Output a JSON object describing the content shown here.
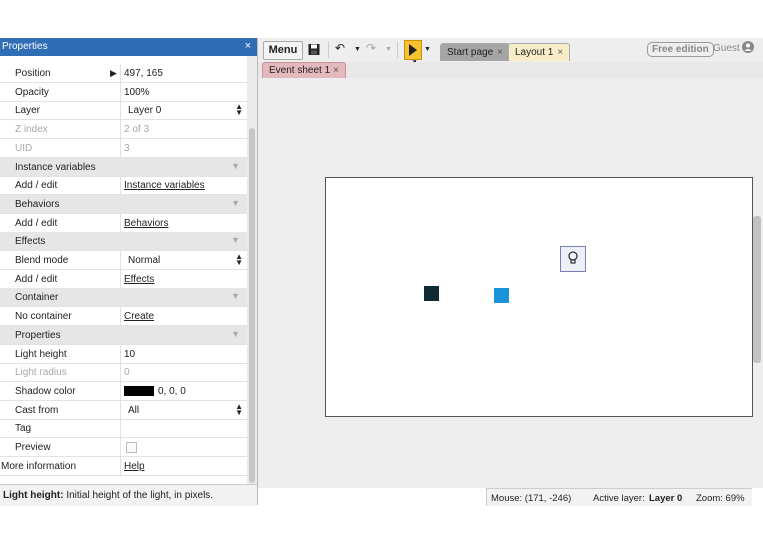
{
  "properties_panel": {
    "title": "Properties",
    "close_glyph": "×",
    "rows": [
      {
        "key": "Position",
        "value": "497, 165",
        "type": "expand"
      },
      {
        "key": "Opacity",
        "value": "100%",
        "type": "text"
      },
      {
        "key": "Layer",
        "value": "Layer 0",
        "type": "select"
      },
      {
        "key": "Z index",
        "value": "2 of 3",
        "type": "dim"
      },
      {
        "key": "UID",
        "value": "3",
        "type": "dim"
      },
      {
        "key": "Instance variables",
        "type": "section"
      },
      {
        "key": "Add / edit",
        "value": "Instance variables",
        "type": "link"
      },
      {
        "key": "Behaviors",
        "type": "section"
      },
      {
        "key": "Add / edit",
        "value": "Behaviors",
        "type": "link"
      },
      {
        "key": "Effects",
        "type": "section"
      },
      {
        "key": "Blend mode",
        "value": "Normal",
        "type": "select"
      },
      {
        "key": "Add / edit",
        "value": "Effects",
        "type": "link"
      },
      {
        "key": "Container",
        "type": "section"
      },
      {
        "key": "No container",
        "value": "Create",
        "type": "link"
      },
      {
        "key": "Properties",
        "type": "section"
      },
      {
        "key": "Light height",
        "value": "10",
        "type": "text"
      },
      {
        "key": "Light radius",
        "value": "0",
        "type": "dim"
      },
      {
        "key": "Shadow color",
        "value": "0, 0, 0",
        "type": "color"
      },
      {
        "key": "Cast from",
        "value": "All",
        "type": "select"
      },
      {
        "key": "Tag",
        "value": "",
        "type": "text"
      },
      {
        "key": "Preview",
        "value": "",
        "type": "checkbox"
      },
      {
        "key": "More information",
        "value": "Help",
        "type": "link-wide"
      }
    ],
    "help_bold": "Light height:",
    "help_text": " Initial height of the light, in pixels."
  },
  "toolbar": {
    "menu_label": "Menu",
    "tabs": [
      {
        "label": "Start page",
        "close": "×"
      },
      {
        "label": "Layout 1",
        "close": "×"
      }
    ],
    "free_edition": "Free edition",
    "guest": "Guest"
  },
  "event_tab": {
    "label": "Event sheet 1",
    "close": "×"
  },
  "status_bar": {
    "mouse": "Mouse: (171, -246)",
    "active_layer_label": "Active layer:",
    "active_layer_value": "Layer 0",
    "zoom": "Zoom: 69%"
  },
  "colors": {
    "title_bar": "#2f6db5",
    "play_button": "#f6c232",
    "layout_tab": "#f7ecc8",
    "event_tab": "#e5b8bd",
    "sprite_dark": "#0e2a33",
    "sprite_blue": "#1994d8",
    "shadow_color_swatch": "#000000"
  },
  "icons": [
    "close-icon",
    "save-icon",
    "undo-icon",
    "redo-icon",
    "play-icon",
    "user-icon",
    "lightbulb-icon",
    "chevron-down-icon",
    "expand-arrow-icon"
  ]
}
